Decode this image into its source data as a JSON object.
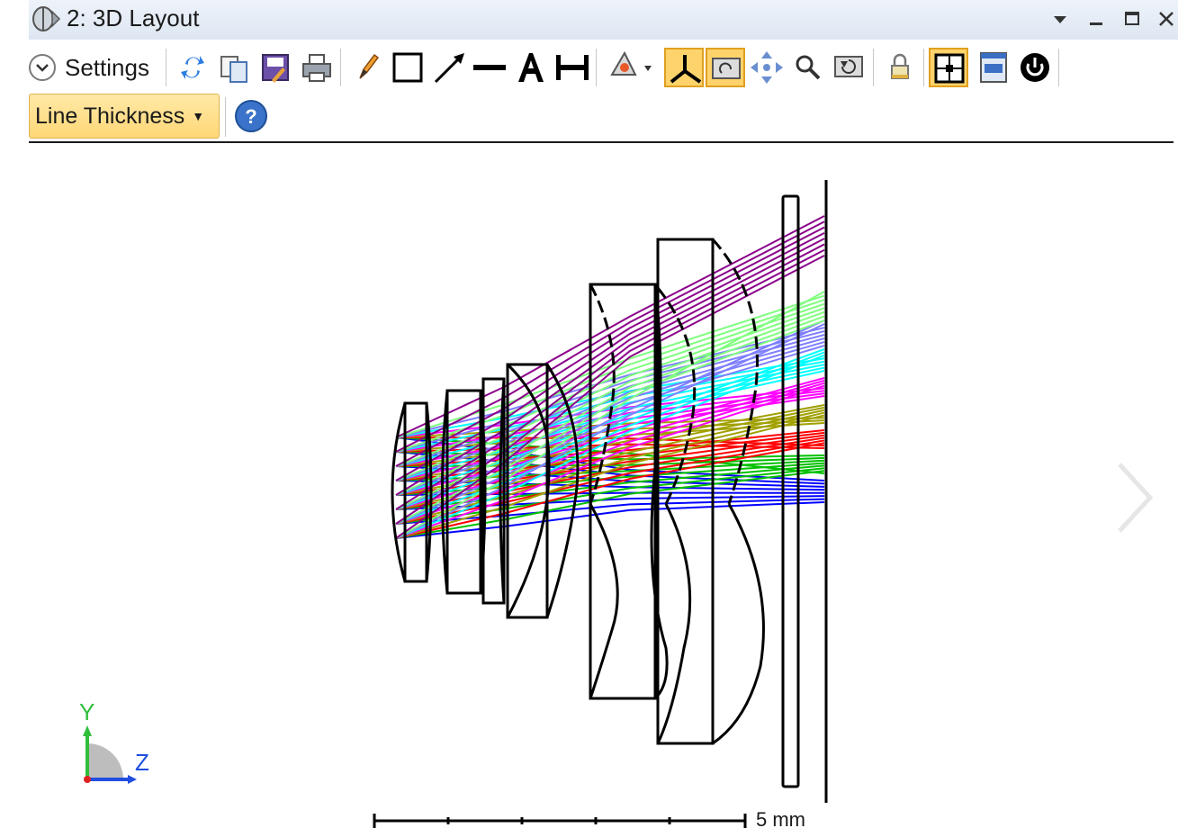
{
  "window": {
    "title": "2: 3D Layout",
    "title_icon": "lens-globe-icon",
    "controls": [
      "menu-dropdown-icon",
      "minimize-icon",
      "maximize-icon",
      "close-icon"
    ]
  },
  "toolbar": {
    "settings_label": "Settings",
    "icons": [
      "refresh-icon",
      "copy-icon",
      "save-icon",
      "print-icon",
      "pencil-icon",
      "rectangle-icon",
      "arrow-icon",
      "line-icon",
      "text-icon",
      "dimension-icon",
      "rotate-tool-icon",
      "axes-icon",
      "fit-icon",
      "pan-icon",
      "zoom-icon",
      "undo-icon",
      "lock-icon",
      "layout-icon",
      "window-icon",
      "power-icon"
    ],
    "active_icons": [
      "axes-icon",
      "fit-icon",
      "layout-icon"
    ]
  },
  "toolbar2": {
    "line_thickness_label": "Line Thickness",
    "help_icon": "help-icon"
  },
  "plot": {
    "scale_bar_label": "5 mm",
    "axis_labels": {
      "y": "Y",
      "z": "Z"
    },
    "ray_colors": [
      "#0000ff",
      "#00c000",
      "#ff0000",
      "#a0a000",
      "#ff00ff",
      "#00ffff",
      "#7f7fff",
      "#7fff7f",
      "#8b008b"
    ],
    "lens_color": "#000000"
  }
}
